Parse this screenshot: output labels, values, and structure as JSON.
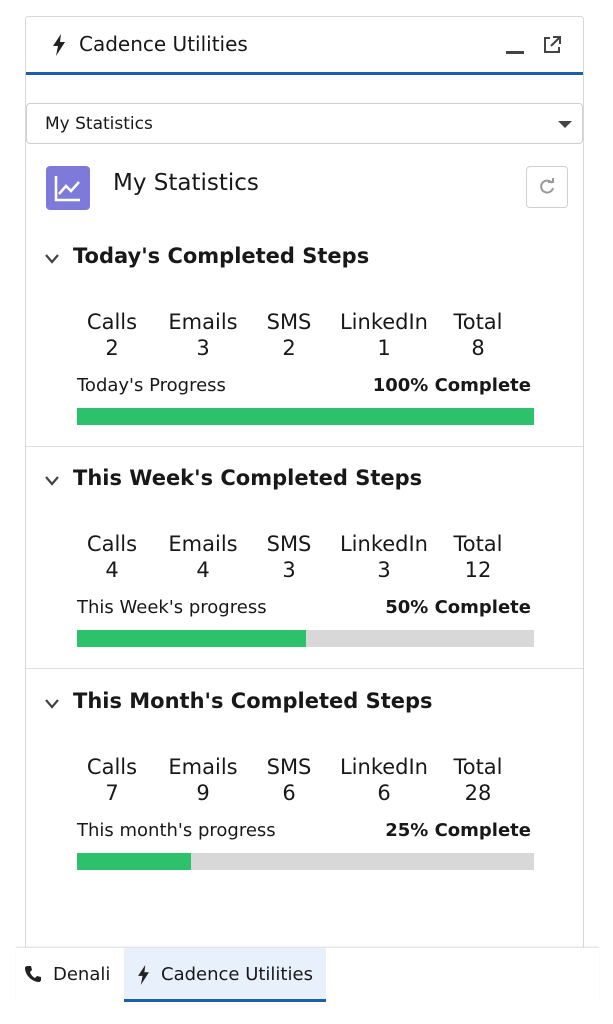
{
  "header": {
    "title": "Cadence Utilities"
  },
  "selector": {
    "value": "My Statistics"
  },
  "stats": {
    "title": "My Statistics"
  },
  "sections": [
    {
      "title": "Today's Completed Steps",
      "metrics": [
        {
          "label": "Calls",
          "value": "2"
        },
        {
          "label": "Emails",
          "value": "3"
        },
        {
          "label": "SMS",
          "value": "2"
        },
        {
          "label": "LinkedIn",
          "value": "1"
        },
        {
          "label": "Total",
          "value": "8"
        }
      ],
      "progress_label": "Today's Progress",
      "progress_text": "100% Complete",
      "progress_fraction": 1.0
    },
    {
      "title": "This Week's Completed Steps",
      "metrics": [
        {
          "label": "Calls",
          "value": "4"
        },
        {
          "label": "Emails",
          "value": "4"
        },
        {
          "label": "SMS",
          "value": "3"
        },
        {
          "label": "LinkedIn",
          "value": "3"
        },
        {
          "label": "Total",
          "value": "12"
        }
      ],
      "progress_label": "This Week's progress",
      "progress_text": "50% Complete",
      "progress_fraction": 0.5
    },
    {
      "title": "This Month's Completed Steps",
      "metrics": [
        {
          "label": "Calls",
          "value": "7"
        },
        {
          "label": "Emails",
          "value": "9"
        },
        {
          "label": "SMS",
          "value": "6"
        },
        {
          "label": "LinkedIn",
          "value": "6"
        },
        {
          "label": "Total",
          "value": "28"
        }
      ],
      "progress_label": "This month's progress",
      "progress_text": "25% Complete",
      "progress_fraction": 0.25
    }
  ],
  "utility_bar": [
    {
      "label": "Denali",
      "icon": "phone-icon"
    },
    {
      "label": "Cadence Utilities",
      "icon": "bolt-icon",
      "active": true
    }
  ],
  "colors": {
    "accent": "#1b5fa8",
    "progress": "#2cc16a",
    "track": "#d8d8d8",
    "icon_bg": "#7e7ad9"
  }
}
